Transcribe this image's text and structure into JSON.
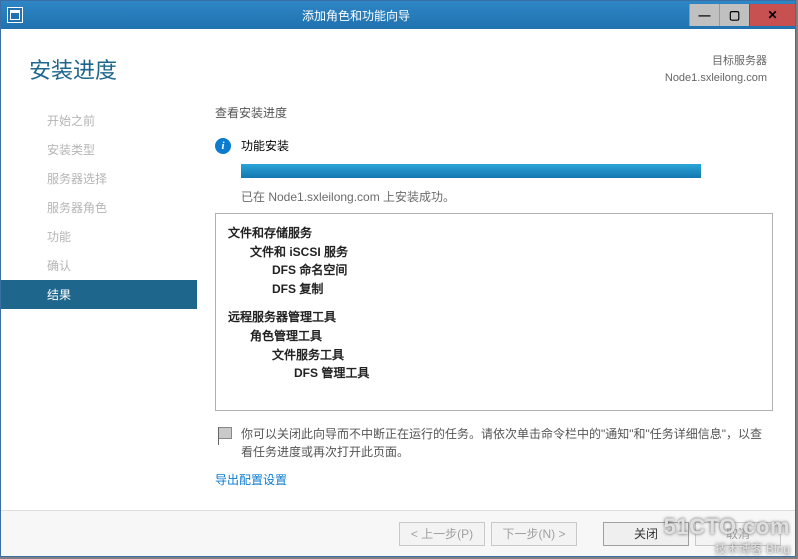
{
  "window": {
    "title": "添加角色和功能向导"
  },
  "header": {
    "page_title": "安装进度",
    "target_label": "目标服务器",
    "target_value": "Node1.sxleilong.com"
  },
  "sidebar": {
    "items": [
      {
        "label": "开始之前"
      },
      {
        "label": "安装类型"
      },
      {
        "label": "服务器选择"
      },
      {
        "label": "服务器角色"
      },
      {
        "label": "功能"
      },
      {
        "label": "确认"
      },
      {
        "label": "结果"
      }
    ],
    "active_index": 6
  },
  "main": {
    "subhead": "查看安装进度",
    "status_text": "功能安装",
    "done_text": "已在 Node1.sxleilong.com 上安装成功。",
    "details": {
      "g1": "文件和存储服务",
      "g1a": "文件和 iSCSI 服务",
      "g1a1": "DFS 命名空间",
      "g1a2": "DFS 复制",
      "g2": "远程服务器管理工具",
      "g2a": "角色管理工具",
      "g2a1": "文件服务工具",
      "g2a1a": "DFS 管理工具"
    },
    "note": "你可以关闭此向导而不中断正在运行的任务。请依次单击命令栏中的\"通知\"和\"任务详细信息\"，以查看任务进度或再次打开此页面。",
    "export_link": "导出配置设置"
  },
  "footer": {
    "prev": "< 上一步(P)",
    "next": "下一步(N) >",
    "close": "关闭",
    "cancel": "取消"
  },
  "watermark": {
    "big": "51CTO.com",
    "small": "技术博客  Blog"
  }
}
